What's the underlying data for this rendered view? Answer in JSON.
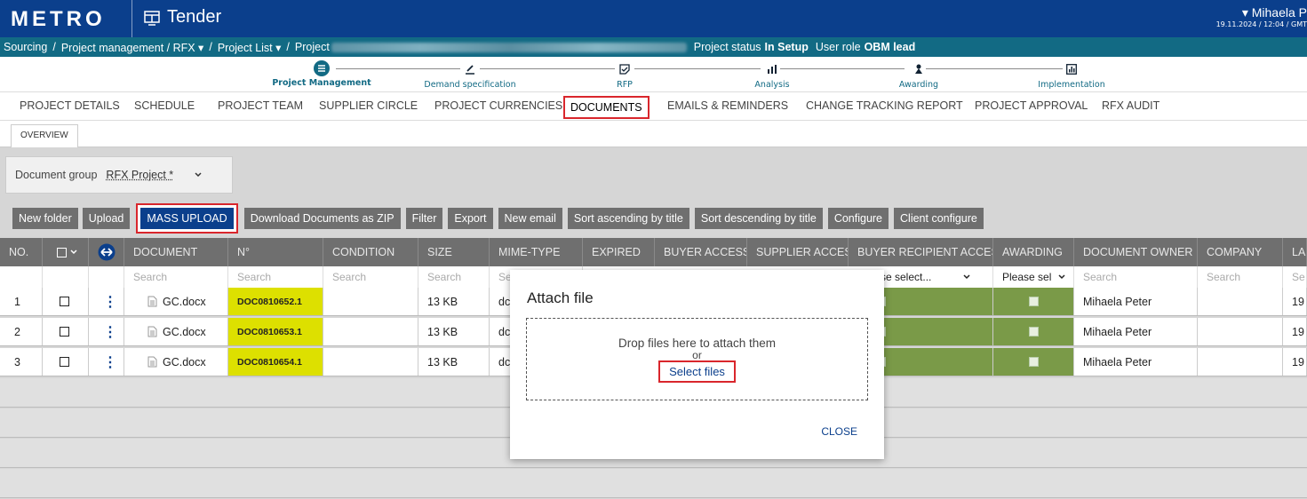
{
  "header": {
    "logo": "METRO",
    "app_title": "Tender",
    "user_name": "▾ Mihaela P",
    "user_date": "19.11.2024 / 12:04 / GMT"
  },
  "breadcrumb": {
    "items": [
      "Sourcing",
      "/",
      "Project management / RFX ▾",
      "/",
      "Project List ▾",
      "/",
      "Project"
    ],
    "status_label": "Project status",
    "status_value": "In Setup",
    "role_label": "User role",
    "role_value": "OBM lead"
  },
  "stepper": [
    "Project Management",
    "Demand specification",
    "RFP",
    "Analysis",
    "Awarding",
    "Implementation"
  ],
  "tabs": [
    "PROJECT DETAILS",
    "SCHEDULE",
    "PROJECT TEAM",
    "SUPPLIER CIRCLE",
    "PROJECT CURRENCIES",
    "DOCUMENTS",
    "EMAILS & REMINDERS",
    "CHANGE TRACKING REPORT",
    "PROJECT APPROVAL",
    "RFX AUDIT"
  ],
  "subtab": "OVERVIEW",
  "doc_group": {
    "label": "Document group",
    "value": "RFX Project *"
  },
  "toolbar": [
    "New folder",
    "Upload",
    "MASS UPLOAD",
    "Download Documents as ZIP",
    "Filter",
    "Export",
    "New email",
    "Sort ascending by title",
    "Sort descending by title",
    "Configure",
    "Client configure"
  ],
  "table": {
    "columns": [
      "NO.",
      "",
      "",
      "DOCUMENT",
      "N°",
      "CONDITION",
      "SIZE",
      "MIME-TYPE",
      "EXPIRED",
      "BUYER ACCESS",
      "SUPPLIER ACCESS",
      "BUYER RECIPIENT ACCESS",
      "AWARDING",
      "DOCUMENT OWNER",
      "COMPANY",
      "LA"
    ],
    "search_placeholder": "Search",
    "please_select_long": "se select...",
    "please_select_short": "Please sel",
    "rows": [
      {
        "no": "1",
        "document": "GC.docx",
        "number": "DOC0810652.1",
        "size": "13 KB",
        "mime": "dc",
        "owner": "Mihaela Peter",
        "last": "19"
      },
      {
        "no": "2",
        "document": "GC.docx",
        "number": "DOC0810653.1",
        "size": "13 KB",
        "mime": "dc",
        "owner": "Mihaela Peter",
        "last": "19"
      },
      {
        "no": "3",
        "document": "GC.docx",
        "number": "DOC0810654.1",
        "size": "13 KB",
        "mime": "dc",
        "owner": "Mihaela Peter",
        "last": "19"
      }
    ]
  },
  "modal": {
    "title": "Attach file",
    "drop_text": "Drop files here to attach them",
    "or_text": "or",
    "select_files": "Select files",
    "close": "CLOSE"
  },
  "colors": {
    "brand": "#0b3f8c",
    "breadcrumb": "#126a84",
    "highlight": "#d9262c",
    "doc_number": "#dde000",
    "access_green": "#7a9a48"
  }
}
